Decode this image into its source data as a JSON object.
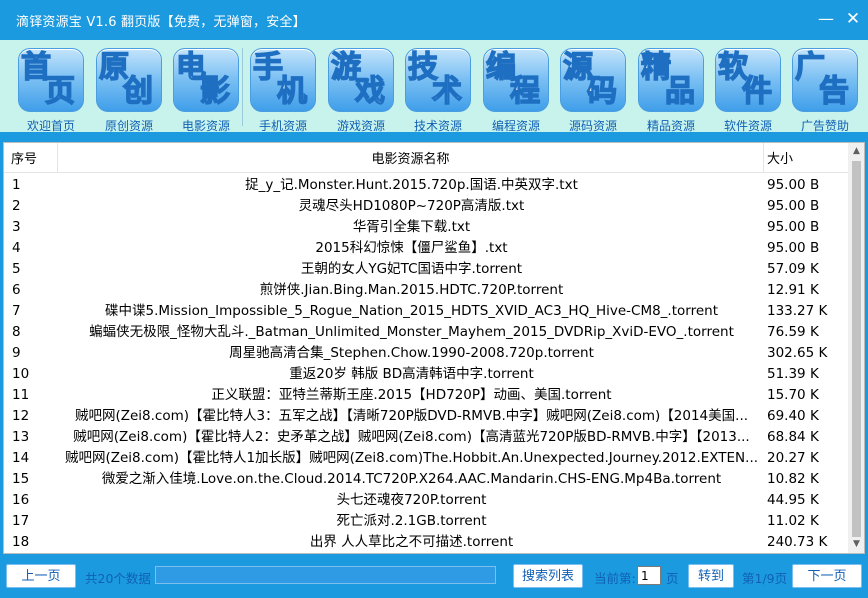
{
  "window": {
    "title": "滴铎资源宝 V1.6 翻页版【免费，无弹窗，安全】",
    "minimize": "—",
    "close": "✕"
  },
  "toolbar": [
    {
      "icon": "homepage-icon",
      "c1": "首",
      "c2": "页",
      "label": "欢迎首页"
    },
    {
      "icon": "original-icon",
      "c1": "原",
      "c2": "创",
      "label": "原创资源"
    },
    {
      "icon": "movie-icon",
      "c1": "电",
      "c2": "影",
      "label": "电影资源"
    },
    {
      "icon": "phone-icon",
      "c1": "手",
      "c2": "机",
      "label": "手机资源"
    },
    {
      "icon": "game-icon",
      "c1": "游",
      "c2": "戏",
      "label": "游戏资源"
    },
    {
      "icon": "tech-icon",
      "c1": "技",
      "c2": "术",
      "label": "技术资源"
    },
    {
      "icon": "code-icon",
      "c1": "编",
      "c2": "程",
      "label": "编程资源"
    },
    {
      "icon": "source-code-icon",
      "c1": "源",
      "c2": "码",
      "label": "源码资源"
    },
    {
      "icon": "featured-icon",
      "c1": "精",
      "c2": "品",
      "label": "精品资源"
    },
    {
      "icon": "software-icon",
      "c1": "软",
      "c2": "件",
      "label": "软件资源"
    },
    {
      "icon": "ad-icon",
      "c1": "广",
      "c2": "告",
      "label": "广告赞助"
    }
  ],
  "table": {
    "headers": {
      "num": "序号",
      "name": "电影资源名称",
      "size": "大小"
    },
    "rows": [
      {
        "num": "1",
        "name": "捉_y_记.Monster.Hunt.2015.720p.国语.中英双字.txt",
        "size": "95.00 B"
      },
      {
        "num": "2",
        "name": "灵魂尽头HD1080P~720P高清版.txt",
        "size": "95.00 B"
      },
      {
        "num": "3",
        "name": "华胥引全集下载.txt",
        "size": "95.00 B"
      },
      {
        "num": "4",
        "name": "2015科幻惊悚【僵尸鲨鱼】.txt",
        "size": "95.00 B"
      },
      {
        "num": "5",
        "name": "王朝的女人YG妃TC国语中字.torrent",
        "size": "57.09 K"
      },
      {
        "num": "6",
        "name": "煎饼侠.Jian.Bing.Man.2015.HDTC.720P.torrent",
        "size": "12.91 K"
      },
      {
        "num": "7",
        "name": "碟中谍5.Mission_Impossible_5_Rogue_Nation_2015_HDTS_XVID_AC3_HQ_Hive-CM8_.torrent",
        "size": "133.27 K"
      },
      {
        "num": "8",
        "name": "蝙蝠侠无极限_怪物大乱斗._Batman_Unlimited_Monster_Mayhem_2015_DVDRip_XviD-EVO_.torrent",
        "size": "76.59 K"
      },
      {
        "num": "9",
        "name": "周星驰高清合集_Stephen.Chow.1990-2008.720p.torrent",
        "size": "302.65 K"
      },
      {
        "num": "10",
        "name": "重返20岁 韩版 BD高清韩语中字.torrent",
        "size": "51.39 K"
      },
      {
        "num": "11",
        "name": "正义联盟：亚特兰蒂斯王座.2015【HD720P】动画、美国.torrent",
        "size": "15.70 K"
      },
      {
        "num": "12",
        "name": "贼吧网(Zei8.com)【霍比特人3：五军之战】【清晰720P版DVD-RMVB.中字】贼吧网(Zei8.com)【2014美国...",
        "size": "69.40 K"
      },
      {
        "num": "13",
        "name": "贼吧网(Zei8.com)【霍比特人2：史矛革之战】贼吧网(Zei8.com)【高清蓝光720P版BD-RMVB.中字】【2013...",
        "size": "68.84 K"
      },
      {
        "num": "14",
        "name": "贼吧网(Zei8.com)【霍比特人1加长版】贼吧网(Zei8.com)The.Hobbit.An.Unexpected.Journey.2012.EXTEN...",
        "size": "20.27 K"
      },
      {
        "num": "15",
        "name": "微爱之渐入佳境.Love.on.the.Cloud.2014.TC720P.X264.AAC.Mandarin.CHS-ENG.Mp4Ba.torrent",
        "size": "10.82 K"
      },
      {
        "num": "16",
        "name": "头七还魂夜720P.torrent",
        "size": "44.95 K"
      },
      {
        "num": "17",
        "name": "死亡派对.2.1GB.torrent",
        "size": "11.02 K"
      },
      {
        "num": "18",
        "name": "出界 人人草比之不可描述.torrent",
        "size": "240.73 K"
      }
    ]
  },
  "scrollbar": {
    "up": "▲",
    "down": "▼"
  },
  "bottom": {
    "prev_label": "上一页",
    "total_text": "共20个数据",
    "progress": 1.0,
    "search_list_label": "搜索列表",
    "current_page_label": "当前第:",
    "current_page_value": "1",
    "page_suffix": "页",
    "goto_label": "转到",
    "page_info": "第1/9页",
    "next_label": "下一页"
  }
}
